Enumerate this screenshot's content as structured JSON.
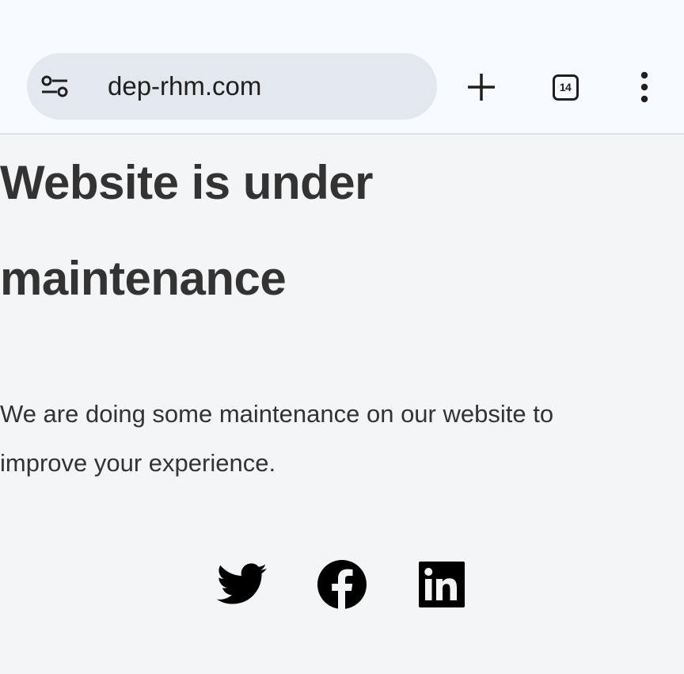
{
  "browser": {
    "url": "dep-rhm.com",
    "tab_count": "14",
    "icons": {
      "site_info": "tune-icon",
      "new_tab": "plus-icon",
      "tabs": "tab-switcher-icon",
      "menu": "more-vert-icon"
    }
  },
  "page": {
    "heading": "Website is under maintenance",
    "description": "We are doing some maintenance on our website to improve your experience.",
    "social": [
      {
        "icon": "twitter-icon"
      },
      {
        "icon": "facebook-icon"
      },
      {
        "icon": "linkedin-icon"
      }
    ]
  },
  "colors": {
    "toolbar_bg": "#f7faff",
    "omnibox_bg": "#e3e7ee",
    "page_bg": "#f4f5f7",
    "text": "#333333"
  }
}
